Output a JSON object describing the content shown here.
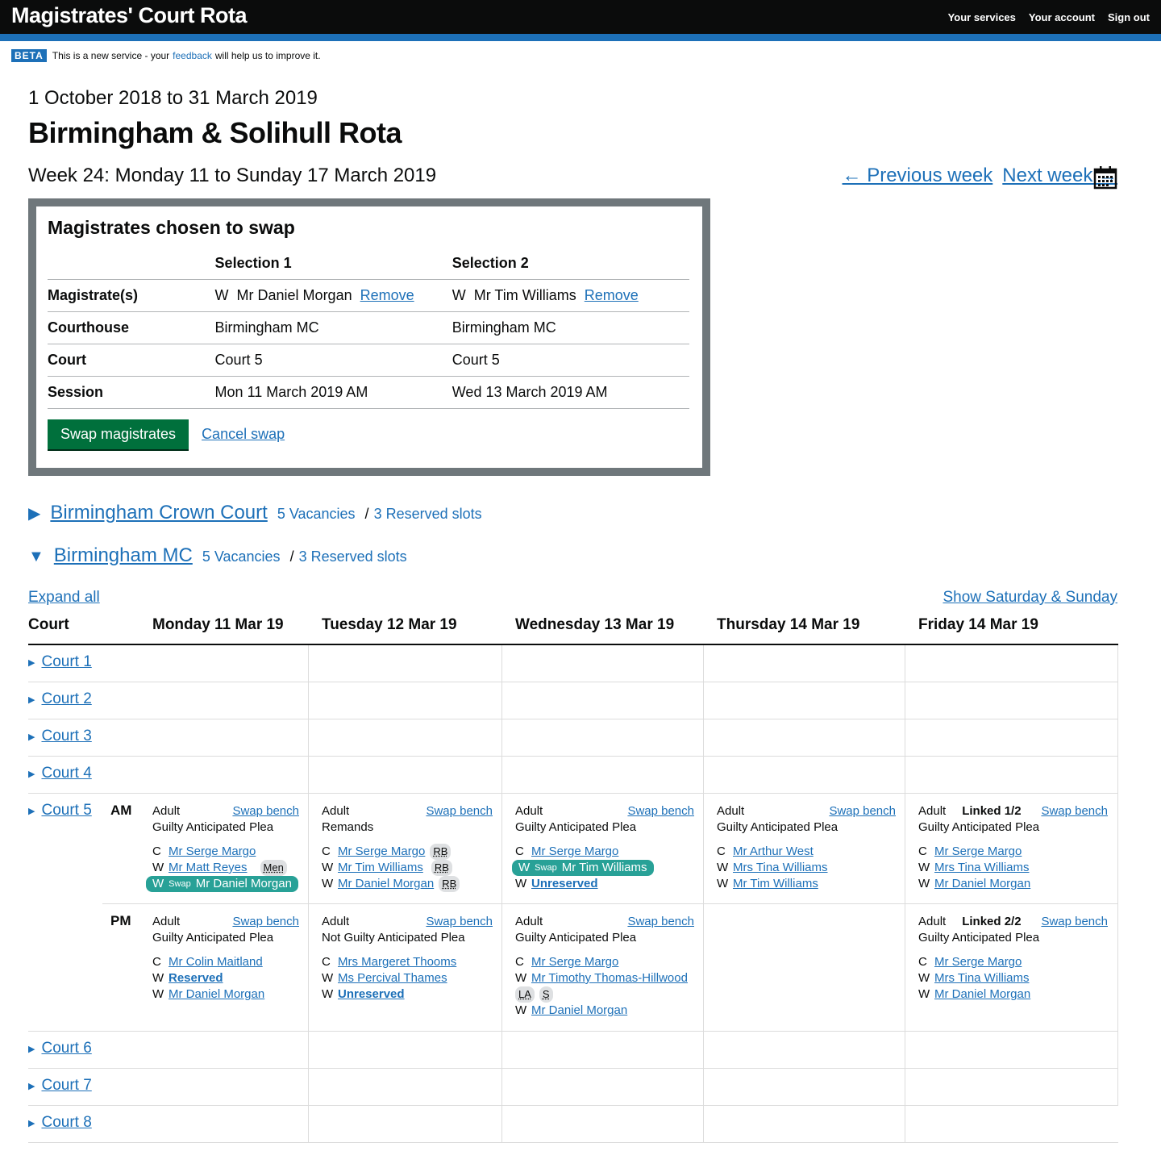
{
  "header": {
    "title": "Magistrates' Court Rota",
    "nav": [
      "Your services",
      "Your account",
      "Sign out"
    ]
  },
  "beta": {
    "tag": "BETA",
    "pre": "This is a new service - your",
    "link": "feedback",
    "post": "will help us to improve it."
  },
  "period": "1 October 2018 to 31 March 2019",
  "rota_title": "Birmingham & Solihull Rota",
  "week": "Week 24: Monday 11 to Sunday 17 March 2019",
  "prev_week": "← Previous week",
  "next_week": "Next week →",
  "swap": {
    "title": "Magistrates chosen to swap",
    "col1": "Selection 1",
    "col2": "Selection 2",
    "rows": [
      {
        "label": "Magistrate(s)",
        "s1": "W  Mr Daniel Morgan",
        "s2": "W  Mr Tim Williams"
      },
      {
        "label": "Courthouse",
        "s1": "Birmingham MC",
        "s2": "Birmingham MC"
      },
      {
        "label": "Court",
        "s1": "Court 5",
        "s2": "Court 5"
      },
      {
        "label": "Session",
        "s1": "Mon 11 March 2019 AM",
        "s2": "Wed 13 March 2019 AM"
      }
    ],
    "remove": "Remove",
    "swap_button": "Swap magistrates",
    "cancel": "Cancel swap"
  },
  "courthouses": [
    {
      "arrow": "▶",
      "name": "Birmingham Crown Court",
      "vacancies": "5 Vacancies",
      "sep": "/",
      "reserved": "3 Reserved slots"
    },
    {
      "arrow": "▼",
      "name": "Birmingham MC",
      "vacancies": "5 Vacancies",
      "sep": "/",
      "reserved": "3 Reserved slots"
    }
  ],
  "expand_all": "Expand all",
  "show_weekend": "Show Saturday & Sunday",
  "grid": {
    "headers": [
      "Court",
      "Monday 11 Mar 19",
      "Tuesday 12 Mar 19",
      "Wednesday 13 Mar 19",
      "Thursday 14 Mar 19",
      "Friday 14 Mar 19"
    ],
    "courts": [
      "Court 1",
      "Court 2",
      "Court 3",
      "Court 4",
      "Court 5",
      "Court 6",
      "Court 7",
      "Court 8"
    ],
    "am": "AM",
    "pm": "PM",
    "swap_bench": "Swap bench",
    "swap_tag": "Swap",
    "sessions": {
      "am_mon": {
        "type": "Adult",
        "sub": "Guilty Anticipated Plea",
        "c": "Mr Serge Margo",
        "w1": "Mr Matt Reyes",
        "w1b": "Men",
        "w2": "Mr Daniel Morgan"
      },
      "am_tue": {
        "type": "Adult",
        "sub": "Remands",
        "c": "Mr Serge Margo",
        "cb": "RB",
        "w1": "Mr Tim Williams",
        "w1b": "RB",
        "w2": "Mr Daniel Morgan",
        "w2b": "RB"
      },
      "am_wed": {
        "type": "Adult",
        "sub": "Guilty Anticipated Plea",
        "c": "Mr Serge Margo",
        "w1": "Mr Tim Williams",
        "w2": "Unreserved"
      },
      "am_thu": {
        "type": "Adult",
        "sub": "Guilty Anticipated Plea",
        "c": "Mr Arthur West",
        "w1": "Mrs Tina Williams",
        "w2": "Mr Tim Williams"
      },
      "am_fri": {
        "type": "Adult",
        "linked": "Linked 1/2",
        "sub": "Guilty Anticipated Plea",
        "c": "Mr Serge Margo",
        "w1": "Mrs Tina Williams",
        "w2": "Mr Daniel Morgan"
      },
      "pm_mon": {
        "type": "Adult",
        "sub": "Guilty Anticipated Plea",
        "c": "Mr Colin Maitland",
        "w1": "Reserved",
        "w2": "Mr Daniel Morgan"
      },
      "pm_tue": {
        "type": "Adult",
        "sub": "Not Guilty Anticipated Plea",
        "c": "Mrs Margeret Thooms",
        "w1": "Ms Percival Thames",
        "w2": "Unreserved"
      },
      "pm_wed": {
        "type": "Adult",
        "sub": "Guilty Anticipated Plea",
        "c": "Mr Serge Margo",
        "w1": "Mr Timothy Thomas-Hillwood",
        "b1": "LA",
        "b2": "S",
        "w2": "Mr Daniel Morgan"
      },
      "pm_fri": {
        "type": "Adult",
        "linked": "Linked 2/2",
        "sub": "Guilty Anticipated Plea",
        "c": "Mr Serge Margo",
        "w1": "Mrs Tina Williams",
        "w2": "Mr Daniel Morgan"
      }
    },
    "roles": {
      "c": "C",
      "w": "W"
    }
  }
}
